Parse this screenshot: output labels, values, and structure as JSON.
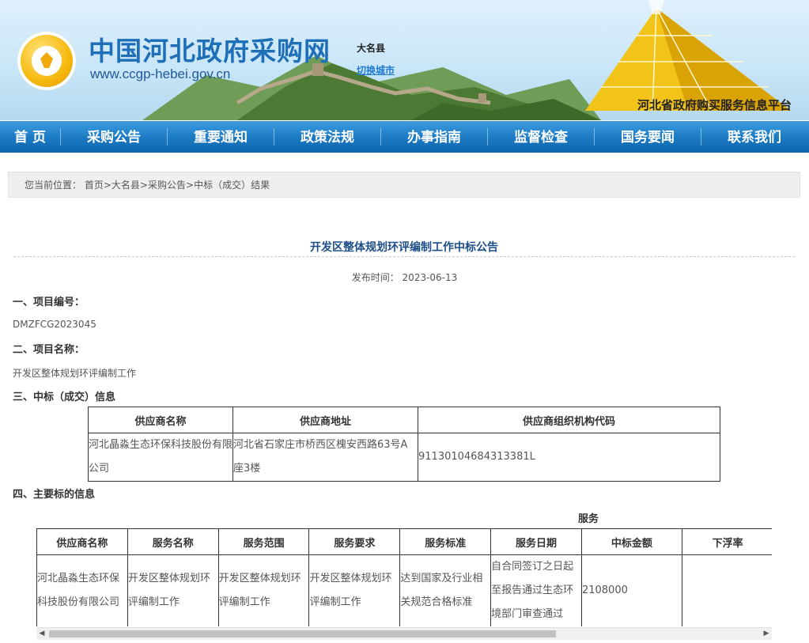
{
  "header": {
    "site_title": "中国河北政府采购网",
    "site_url": "www.ccgp-hebei.gov.cn",
    "city": "大名县",
    "switch_city": "切换城市",
    "platform": "河北省政府购买服务信息平台"
  },
  "nav": [
    {
      "label": "首 页"
    },
    {
      "label": "采购公告"
    },
    {
      "label": "重要通知"
    },
    {
      "label": "政策法规"
    },
    {
      "label": "办事指南"
    },
    {
      "label": "监督检查"
    },
    {
      "label": "国务要闻"
    },
    {
      "label": "联系我们"
    }
  ],
  "breadcrumb": {
    "prefix": "您当前位置：",
    "items": [
      "首页",
      "大名县",
      "采购公告",
      "中标（成交）结果"
    ],
    "sep": ">"
  },
  "article": {
    "title": "开发区整体规划环评编制工作中标公告",
    "pub_label": "发布时间：",
    "pub_date": "2023-06-13",
    "sec1": "一、项目编号：",
    "project_no": "DMZFCG2023045",
    "sec2": "二、项目名称：",
    "project_name": "开发区整体规划环评编制工作",
    "sec3": "三、中标（成交）信息",
    "sec4": "四、主要标的信息"
  },
  "winner_table": {
    "headers": [
      "供应商名称",
      "供应商地址",
      "供应商组织机构代码"
    ],
    "row": [
      "河北晶淼生态环保科技股份有限公司",
      "河北省石家庄市桥西区槐安西路63号A座3楼",
      "91130104684313381L"
    ]
  },
  "service_table": {
    "label": "服务",
    "headers": [
      "供应商名称",
      "服务名称",
      "服务范围",
      "服务要求",
      "服务标准",
      "服务日期",
      "中标金额",
      "下浮率"
    ],
    "row": [
      "河北晶淼生态环保科技股份有限公司",
      "开发区整体规划环评编制工作",
      "开发区整体规划环评编制工作",
      "开发区整体规划环评编制工作",
      "达到国家及行业相关规范合格标准",
      "自合同签订之日起至报告通过生态环境部门审查通过",
      "2108000",
      ""
    ]
  },
  "colors": {
    "nav_blue": "#1a78c2",
    "title_blue": "#1d4e88",
    "logo_gold": "#f6b90e"
  }
}
